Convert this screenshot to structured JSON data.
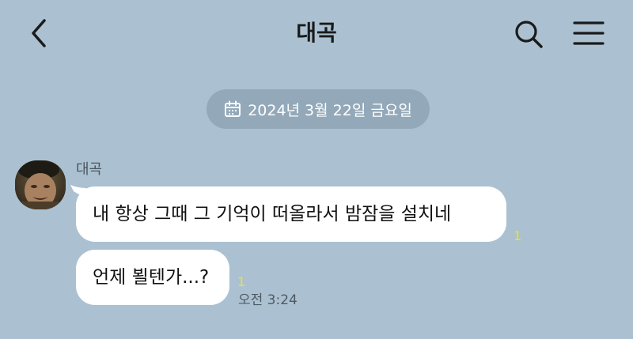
{
  "header": {
    "title": "대곡",
    "back_icon": "chevron-left-icon",
    "search_icon": "search-icon",
    "menu_icon": "hamburger-menu-icon"
  },
  "date_divider": {
    "icon": "calendar-icon",
    "text": "2024년 3월 22일 금요일"
  },
  "messages": [
    {
      "sender": "대곡",
      "text": "내 항상 그때 그 기억이 떠올라서 밤잠을 설치네",
      "unread": "1"
    },
    {
      "text": "언제 뵐텐가...?",
      "unread": "1",
      "time": "오전 3:24"
    }
  ],
  "colors": {
    "background": "#abc1d1",
    "bubble": "#ffffff",
    "date_pill": "#93a9b9",
    "unread": "#f5e600"
  }
}
